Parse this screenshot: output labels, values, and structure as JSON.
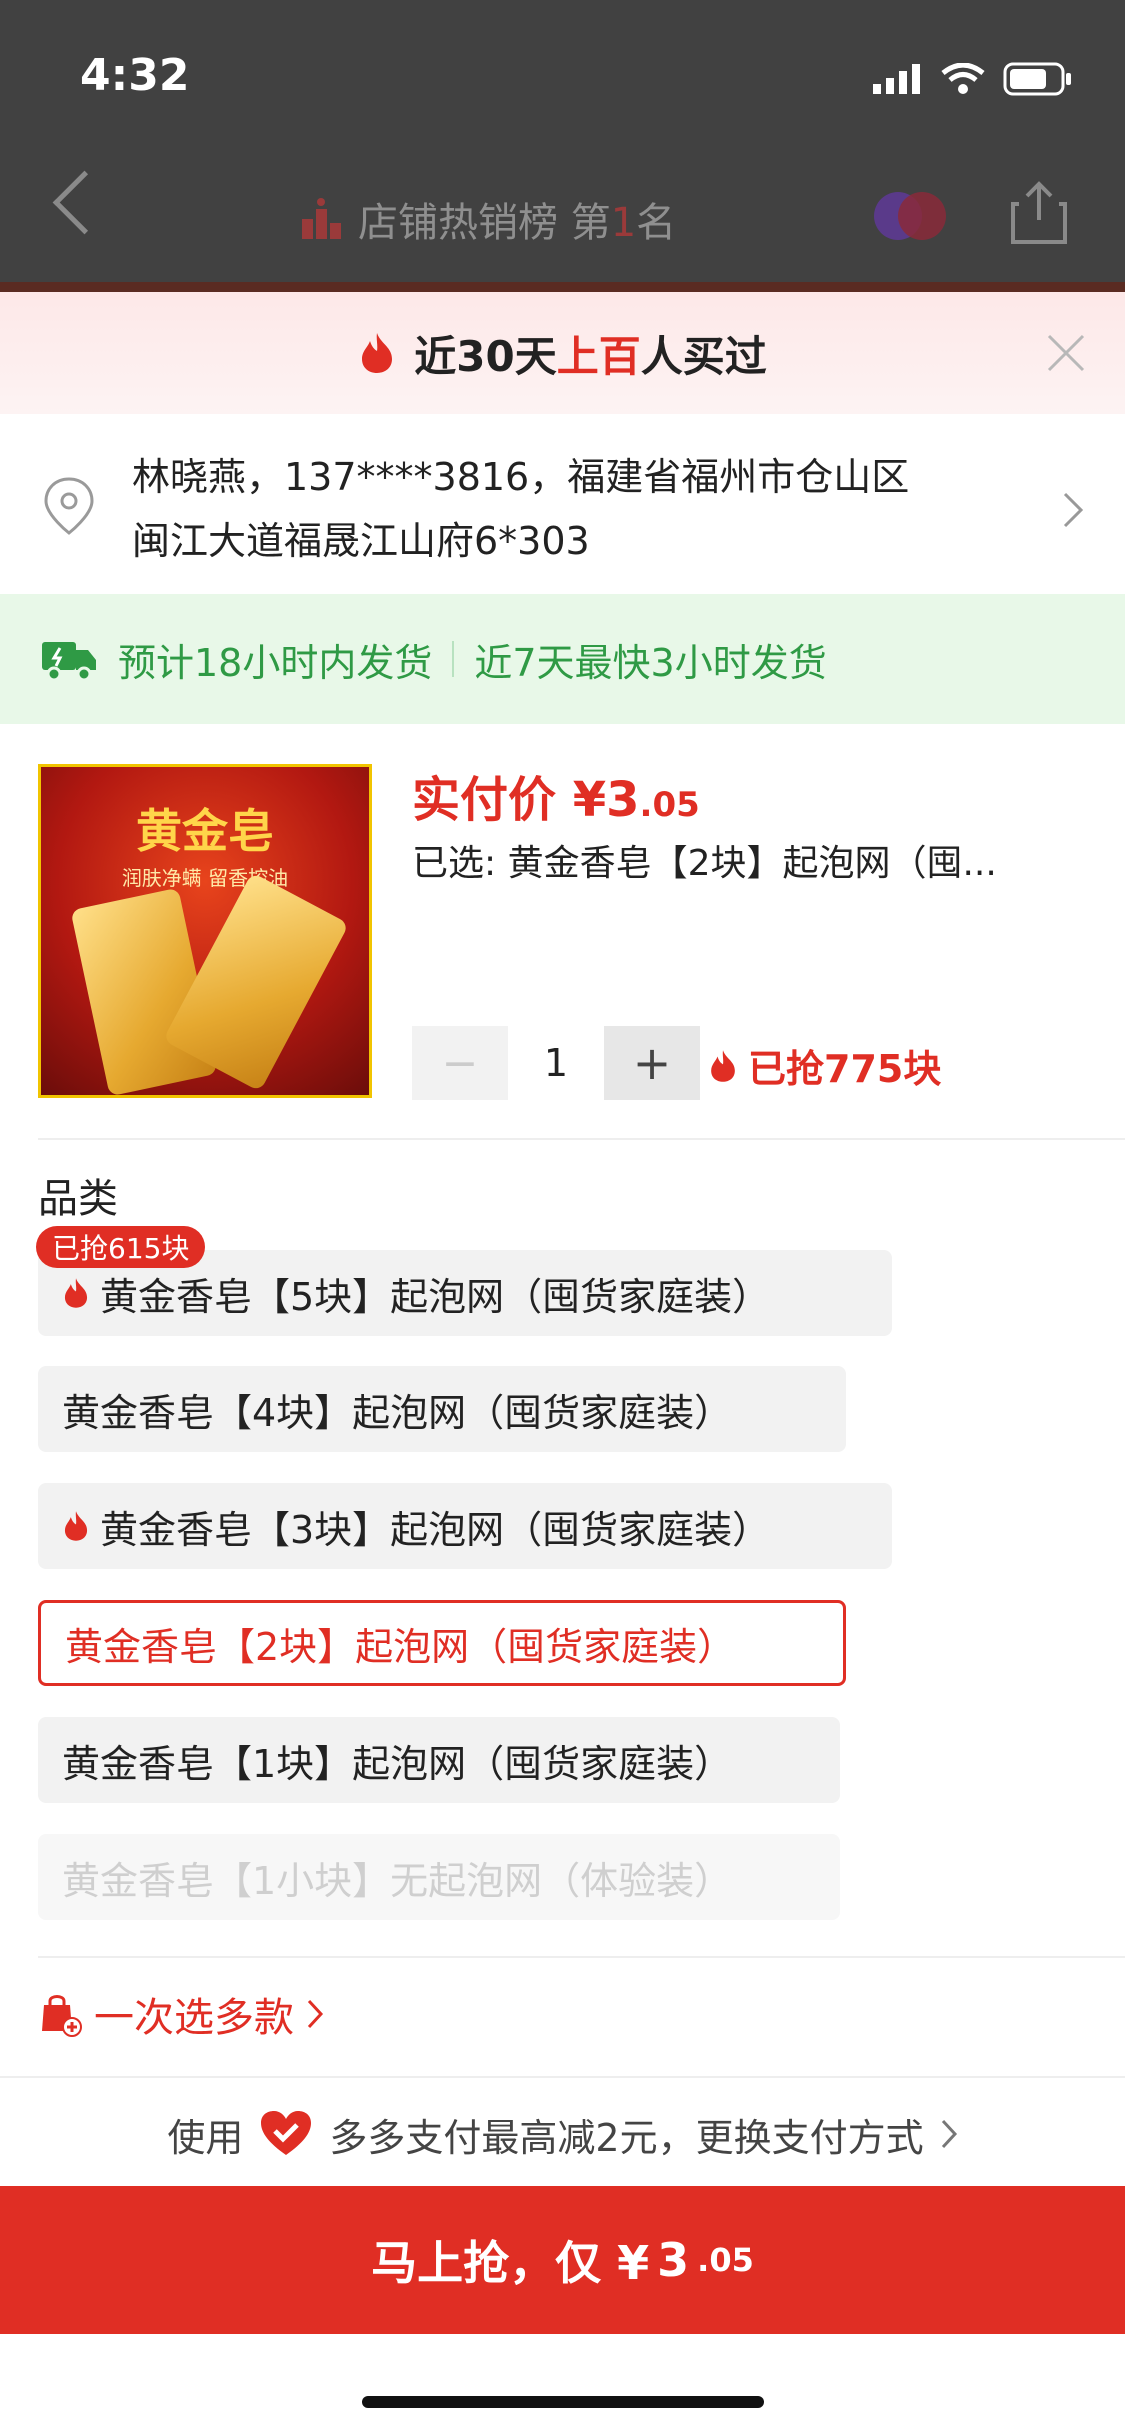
{
  "status_bar": {
    "time": "4:32"
  },
  "nav": {
    "title_prefix": "店铺热销榜 第",
    "rank": "1",
    "title_suffix": "名"
  },
  "banner": {
    "part1": "近30天",
    "highlight": "上百",
    "part2": "人买过"
  },
  "address": {
    "line1": "林晓燕，137****3816，福建省福州市仓山区",
    "line2": "闽江大道福晟江山府6*303"
  },
  "shipping": {
    "estimate": "预计18小时内发货",
    "fastest": "近7天最快3小时发货"
  },
  "product": {
    "image_title": "黄金皂",
    "image_subtitle": "润肤净螨 留香控油",
    "price_label": "实付价 ¥",
    "price_int": "3",
    "price_dec": ".05",
    "selected": "已选: 黄金香皂【2块】起泡网（囤..."
  },
  "quantity": {
    "minus": "−",
    "value": "1",
    "plus": "+",
    "grabbed": "已抢775块"
  },
  "category": {
    "label": "品类",
    "badge": "已抢615块",
    "options": [
      {
        "label": "黄金香皂【5块】起泡网（囤货家庭装）",
        "hot": true,
        "state": "normal"
      },
      {
        "label": "黄金香皂【4块】起泡网（囤货家庭装）",
        "hot": false,
        "state": "normal"
      },
      {
        "label": "黄金香皂【3块】起泡网（囤货家庭装）",
        "hot": true,
        "state": "normal"
      },
      {
        "label": "黄金香皂【2块】起泡网（囤货家庭装）",
        "hot": false,
        "state": "selected"
      },
      {
        "label": "黄金香皂【1块】起泡网（囤货家庭装）",
        "hot": false,
        "state": "normal"
      },
      {
        "label": "黄金香皂【1小块】无起泡网（体验装）",
        "hot": false,
        "state": "disabled"
      }
    ]
  },
  "multi_select": {
    "label": "一次选多款"
  },
  "payment": {
    "prefix": "使用",
    "text": "多多支付最高减2元，更换支付方式"
  },
  "buy_button": {
    "label": "马上抢，仅 ¥",
    "price_int": "3",
    "price_dec": ".05"
  },
  "colors": {
    "accent": "#e02e24",
    "ship_green": "#2f9a45",
    "ship_bg": "#e8f8e8"
  }
}
